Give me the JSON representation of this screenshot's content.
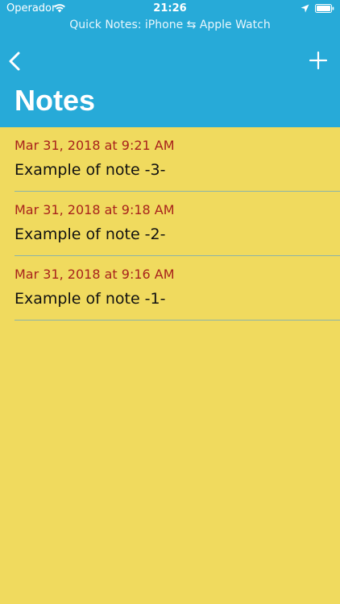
{
  "status_bar": {
    "carrier": "Operador",
    "time": "21:26"
  },
  "header": {
    "subtitle": "Quick Notes: iPhone ⇆ Apple Watch",
    "title": "Notes",
    "back_icon": "chevron-left-icon",
    "add_icon": "plus-icon"
  },
  "notes": [
    {
      "date": "Mar 31, 2018 at 9:21 AM",
      "text": "Example of note -3-"
    },
    {
      "date": "Mar 31, 2018 at 9:18 AM",
      "text": "Example of note -2-"
    },
    {
      "date": "Mar 31, 2018 at 9:16 AM",
      "text": "Example of note -1-"
    }
  ],
  "colors": {
    "header_bg": "#27aad8",
    "page_bg": "#f0da5e",
    "date_text": "#a8231c",
    "separator": "#8cb4a7"
  }
}
